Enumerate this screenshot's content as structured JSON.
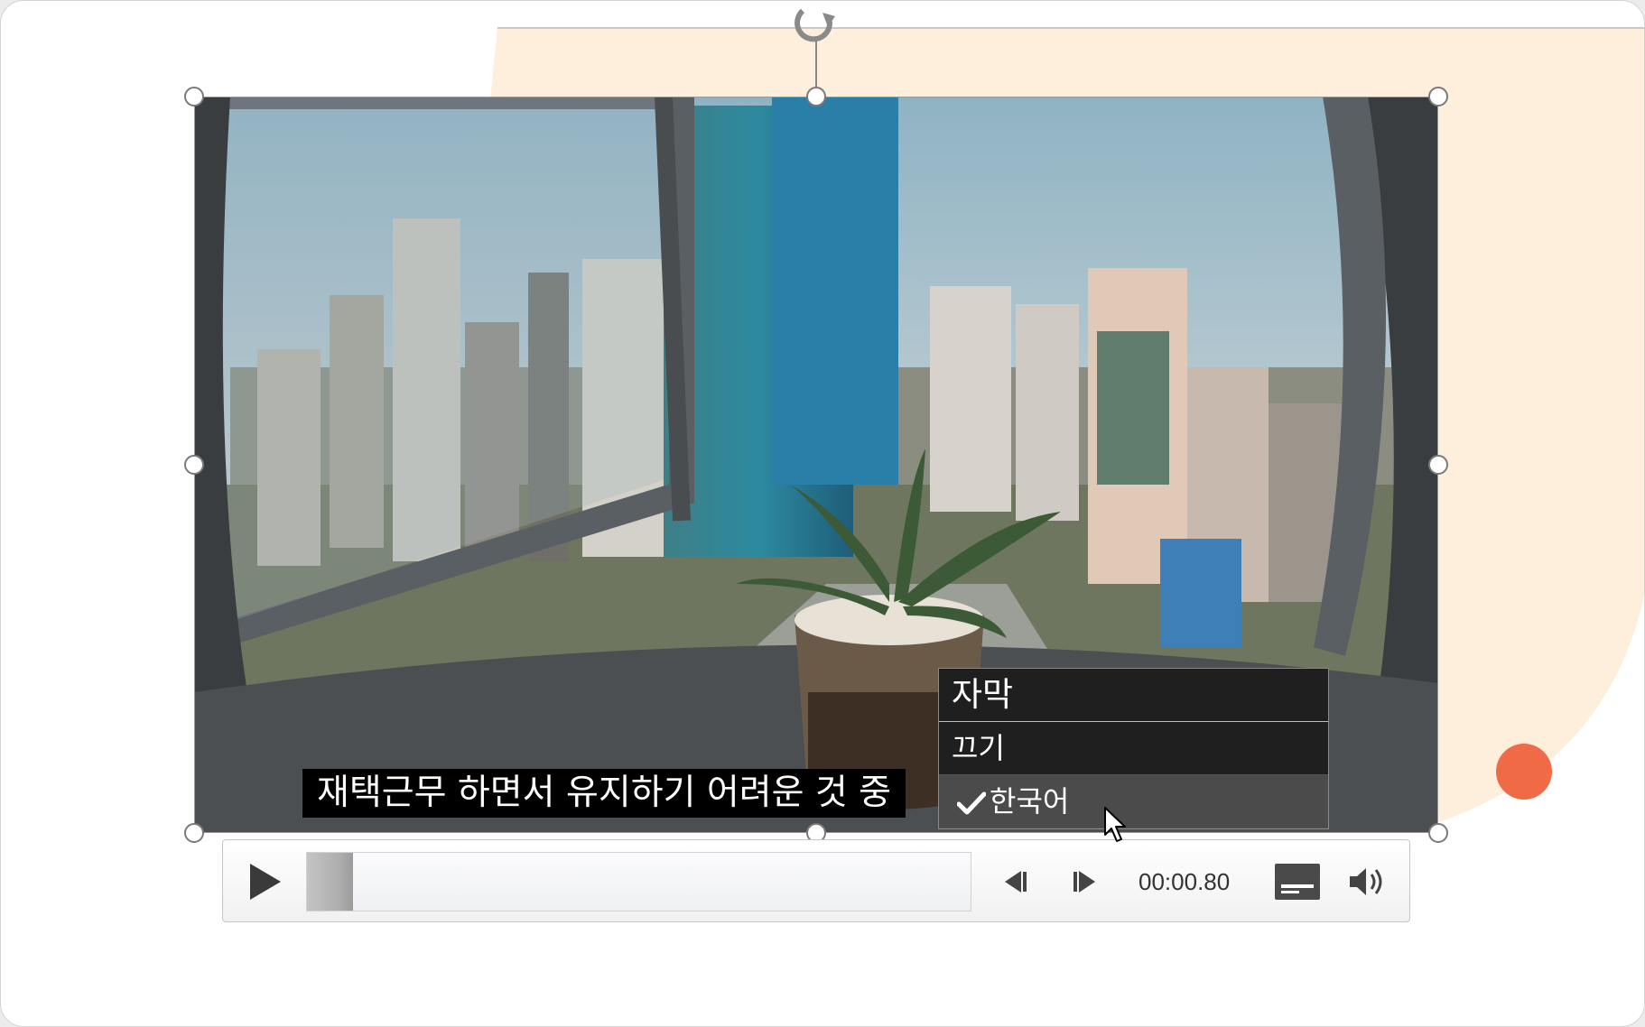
{
  "subtitle": {
    "text": "재택근무 하면서 유지하기 어려운 것 중"
  },
  "captions_menu": {
    "header": "자막",
    "items": [
      {
        "label": "끄기",
        "selected": false
      },
      {
        "label": "한국어",
        "selected": true
      }
    ]
  },
  "player": {
    "current_time": "00:00.80",
    "progress_percent": 7
  },
  "icons": {
    "play": "play-icon",
    "step_back": "step-back-icon",
    "step_forward": "step-forward-icon",
    "captions": "captions-icon",
    "volume": "volume-icon",
    "rotate": "rotate-icon",
    "check": "check-icon",
    "cursor": "mouse-cursor-icon"
  },
  "colors": {
    "peach_background": "#fdefdc",
    "accent_dot": "#ef6a45",
    "menu_background": "#1f1f1f",
    "menu_selected": "#4b4b4b"
  }
}
